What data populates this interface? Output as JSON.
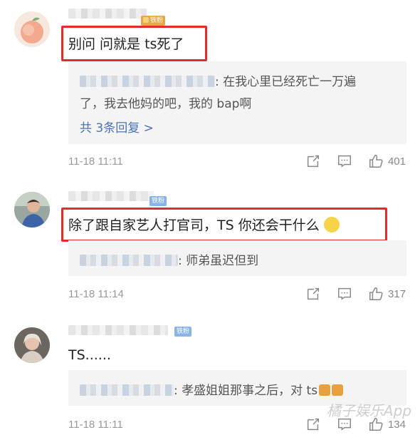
{
  "comments": [
    {
      "badge": "铁粉",
      "text": "别问 问就是 ts死了",
      "reply": {
        "text_line1": ": 在我心里已经死亡一万遍",
        "text_line2": "了，我去他妈的吧，我的 bap啊",
        "more": "共 3条回复 >"
      },
      "time": "11-18 11:11",
      "likes": "401"
    },
    {
      "badge": "铁粉",
      "text": "除了跟自家艺人打官司，TS 你还会干什么",
      "reply": {
        "text_line1": ": 师弟虽迟但到"
      },
      "time": "11-18 11:14",
      "likes": "317"
    },
    {
      "badge": "铁粉",
      "text": "TS......",
      "reply": {
        "text_line1": ": 孝盛姐姐那事之后，对 ts"
      },
      "time": "11-18 11:11",
      "likes": "134"
    }
  ],
  "watermark": "橘子娱乐App",
  "icons": [
    "share-icon",
    "comment-icon",
    "like-icon"
  ],
  "colors": {
    "highlight": "#e02c2c",
    "link": "#4a73b0",
    "meta": "#999999"
  }
}
